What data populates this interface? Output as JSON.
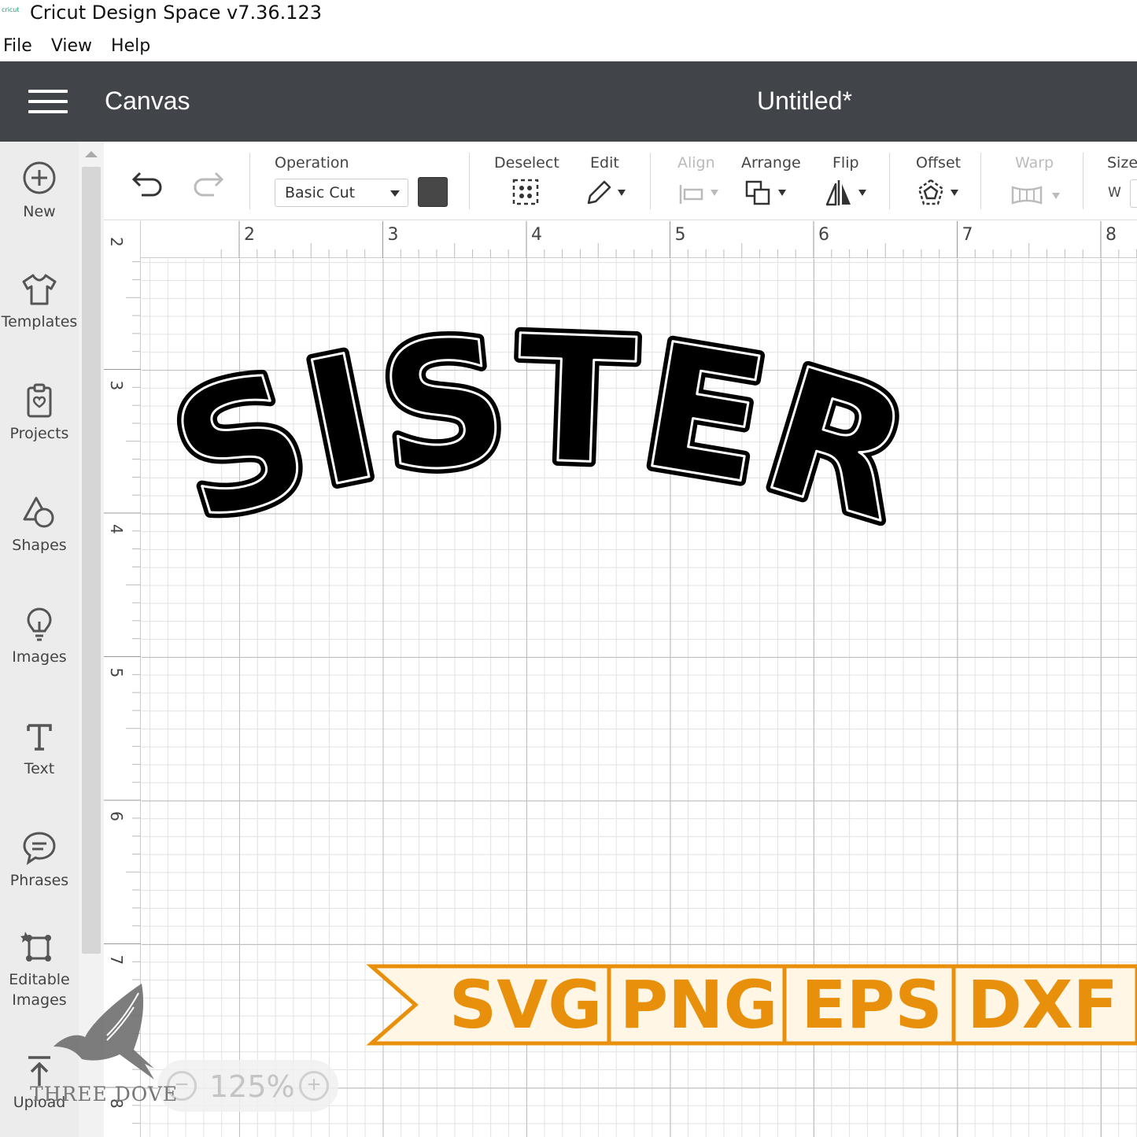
{
  "window": {
    "app_title": "Cricut Design Space  v7.36.123",
    "logo_text": "cricut"
  },
  "menu": {
    "items": [
      "File",
      "View",
      "Help"
    ]
  },
  "header": {
    "section": "Canvas",
    "document_title": "Untitled*"
  },
  "sidebar": {
    "items": [
      {
        "label": "New",
        "icon": "plus-circle-icon"
      },
      {
        "label": "Templates",
        "icon": "shirt-icon"
      },
      {
        "label": "Projects",
        "icon": "projects-icon"
      },
      {
        "label": "Shapes",
        "icon": "shapes-icon"
      },
      {
        "label": "Images",
        "icon": "lightbulb-icon"
      },
      {
        "label": "Text",
        "icon": "text-icon"
      },
      {
        "label": "Phrases",
        "icon": "speech-bubble-icon"
      },
      {
        "label": "Editable",
        "label2": "Images",
        "icon": "editable-images-icon"
      },
      {
        "label": "Upload",
        "icon": "upload-icon"
      }
    ]
  },
  "toolbar": {
    "operation_label": "Operation",
    "operation_value": "Basic Cut",
    "operation_color": "#474747",
    "deselect": "Deselect",
    "edit": "Edit",
    "align": "Align",
    "arrange": "Arrange",
    "flip": "Flip",
    "offset": "Offset",
    "warp": "Warp",
    "size": "Size",
    "size_w": "W"
  },
  "ruler": {
    "top": [
      "2",
      "3",
      "4",
      "5",
      "6",
      "7",
      "8"
    ],
    "left": [
      "2",
      "3",
      "4",
      "5",
      "6",
      "7",
      "8"
    ]
  },
  "canvas": {
    "design_text": "SISTER"
  },
  "banner": {
    "formats": [
      "SVG",
      "PNG",
      "EPS",
      "DXF"
    ],
    "color": "#e8900c",
    "bg": "#fff6e6"
  },
  "zoom": {
    "value": "125%",
    "minus": "−",
    "plus": "+"
  },
  "watermark": "THREE DOVE"
}
